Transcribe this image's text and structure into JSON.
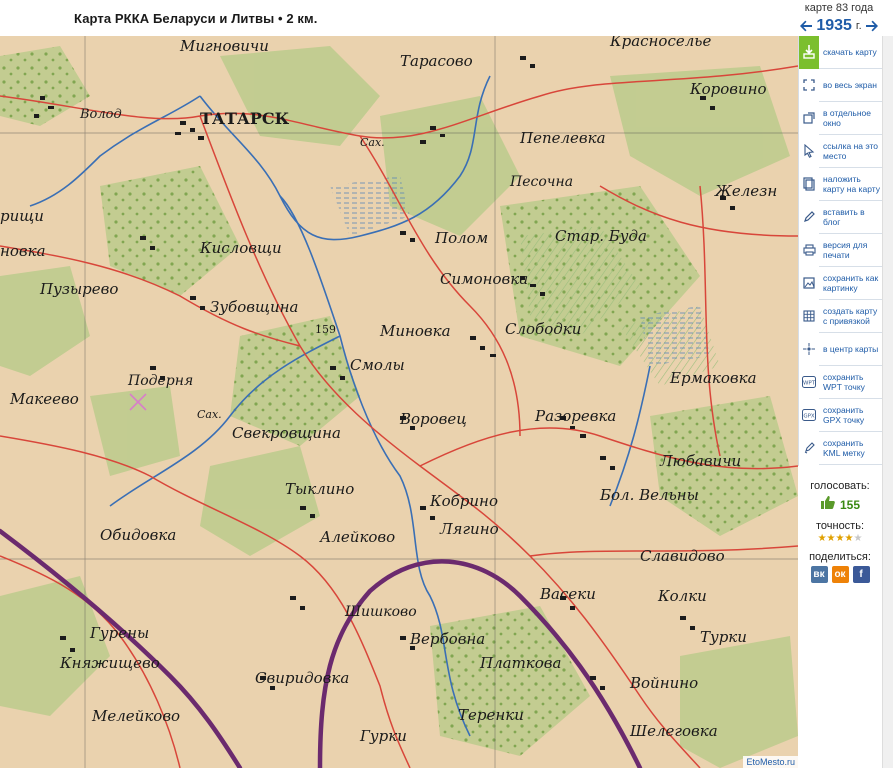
{
  "header": {
    "title": "Карта РККА Беларуси и Литвы • 2 км.",
    "year_note": "карте 83 года",
    "year": "1935",
    "year_unit": "г."
  },
  "map": {
    "credit": "EtoMesto.ru",
    "labels": {
      "tarasovo": "Тарасово",
      "krasnoselye": "Красноселье",
      "mignovichi": "Мигновичи",
      "korovino": "Коровино",
      "volod": "Волод",
      "tatarsk": "ТАТАРСК",
      "pepelevka": "Пепелевка",
      "sch1": "Сах.",
      "pesochna": "Песочна",
      "zhelezn": "Железн",
      "rishchi": "рищи",
      "kislovshchi": "Кисловщи",
      "polom": "Полом",
      "star_buda": "Стар. Буда",
      "novka": "новка",
      "puzyrevo": "Пузырево",
      "simonovka": "Симоновка",
      "zubovshchina": "Зубовщина",
      "minovka": "Миновка",
      "slobodki": "Слободки",
      "elev_159": "159",
      "smoly": "Смолы",
      "poderna": "Подерня",
      "ermakovka": "Ермаковка",
      "makeevo": "Макеево",
      "sch2": "Сах.",
      "vorovets": "Воровец",
      "razorevka": "Разоревка",
      "svekrovshchina": "Свекровщина",
      "lyubavichi": "Любавичи",
      "tyklino": "Тыклино",
      "bol_velny": "Бол. Вельны",
      "kobrino": "Кобрино",
      "obidovka": "Обидовка",
      "aleykovo": "Алейково",
      "lyagino": "Лягино",
      "slavidovo": "Славидово",
      "shishkovo": "Шишково",
      "vaseki": "Васеки",
      "kolki": "Колки",
      "gureny": "Гурены",
      "verbovna": "Вербовна",
      "turki": "Турки",
      "knyazhishchevo": "Княжищево",
      "sviridovka": "Свиридовка",
      "platkova": "Платкова",
      "voynino": "Войнино",
      "meleykovo": "Мелейково",
      "terenki": "Теренки",
      "gurki": "Гурки",
      "shelegovka": "Шелеговка"
    }
  },
  "toolbar": {
    "items": [
      {
        "label": "скачать карту",
        "icon": "download-icon"
      },
      {
        "label": "во весь экран",
        "icon": "fullscreen-icon"
      },
      {
        "label": "в отдельное окно",
        "icon": "new-window-icon"
      },
      {
        "label": "ссылка на это место",
        "icon": "cursor-link-icon"
      },
      {
        "label": "наложить карту на карту",
        "icon": "overlay-icon"
      },
      {
        "label": "вставить в блог",
        "icon": "pencil-icon"
      },
      {
        "label": "версия для печати",
        "icon": "printer-icon"
      },
      {
        "label": "сохранить как картинку",
        "icon": "image-icon"
      },
      {
        "label": "создать карту с привязкой",
        "icon": "grid-icon"
      },
      {
        "label": "в центр карты",
        "icon": "crosshair-icon"
      },
      {
        "label": "сохранить WPT точку",
        "icon": "wpt-icon"
      },
      {
        "label": "сохранить GPX точку",
        "icon": "gpx-icon"
      },
      {
        "label": "сохранить KML метку",
        "icon": "kml-icon"
      }
    ]
  },
  "vote": {
    "title": "голосовать:",
    "count": "155",
    "accuracy_title": "точность:",
    "rating": 4,
    "rating_max": 5
  },
  "share": {
    "title": "поделиться:",
    "buttons": [
      {
        "name": "vk",
        "glyph": "вк",
        "color": "#4c75a3"
      },
      {
        "name": "ok",
        "glyph": "ок",
        "color": "#ee8208"
      },
      {
        "name": "fb",
        "glyph": "f",
        "color": "#3b5998"
      }
    ]
  },
  "colors": {
    "accent": "#1f5ca8",
    "active_tool": "#7bbf2e",
    "map_paper": "#ead2ae",
    "forest": "#b8c98a",
    "road": "#d8463a",
    "river": "#3a6fb5",
    "railway": "#6b2a6e"
  }
}
